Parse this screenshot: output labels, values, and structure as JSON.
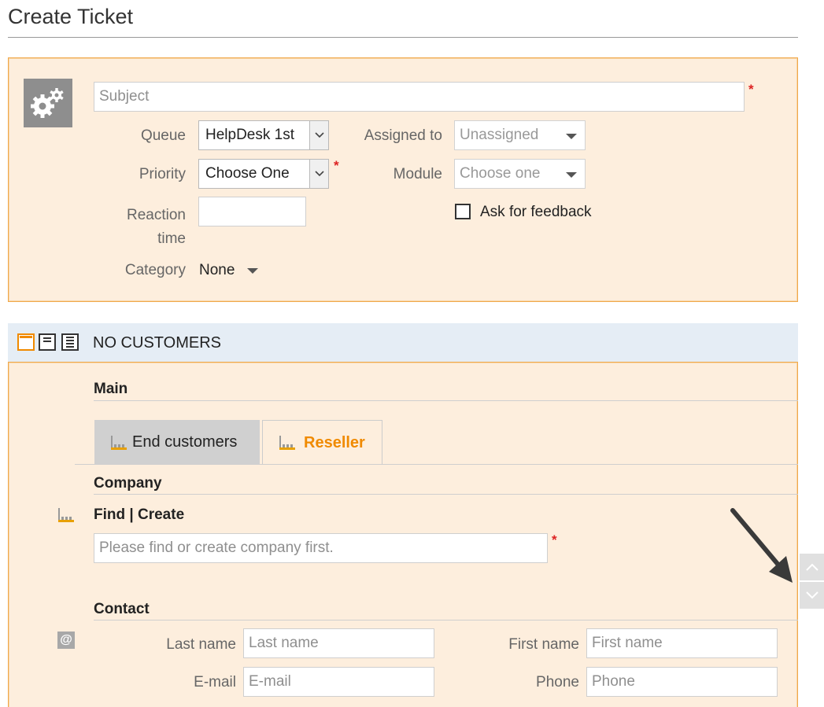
{
  "page": {
    "title": "Create Ticket"
  },
  "ticket": {
    "subject_placeholder": "Subject",
    "required_marker": "*",
    "queue_label": "Queue",
    "queue_value": "HelpDesk 1st",
    "assigned_label": "Assigned to",
    "assigned_value": "Unassigned",
    "priority_label": "Priority",
    "priority_value": "Choose One",
    "module_label": "Module",
    "module_value": "Choose one",
    "reaction_label_line1": "Reaction",
    "reaction_label_line2": "time",
    "feedback_label": "Ask for feedback",
    "feedback_checked": false,
    "category_label": "Category",
    "category_value": "None"
  },
  "customers": {
    "bar_title": "NO CUSTOMERS",
    "main_title": "Main",
    "tabs": [
      {
        "label": "End customers",
        "active": false
      },
      {
        "label": "Reseller",
        "active": true
      }
    ],
    "company_title": "Company",
    "find_label": "Find",
    "separator": "|",
    "create_label": "Create",
    "company_placeholder": "Please find or create company first.",
    "contact_title": "Contact",
    "last_name_label": "Last name",
    "last_name_placeholder": "Last name",
    "first_name_label": "First name",
    "first_name_placeholder": "First name",
    "email_label": "E-mail",
    "email_placeholder": "E-mail",
    "phone_label": "Phone",
    "phone_placeholder": "Phone"
  },
  "colors": {
    "accent": "#f08a00",
    "panel_bg": "#fdeedd",
    "panel_border": "#f0a84a",
    "required": "#dd2222"
  },
  "icons": [
    "gear-icon",
    "layout-one-icon",
    "layout-two-icon",
    "layout-three-icon",
    "factory-icon",
    "at-icon",
    "scroll-up-icon",
    "scroll-down-icon",
    "arrow-annotation-icon"
  ]
}
